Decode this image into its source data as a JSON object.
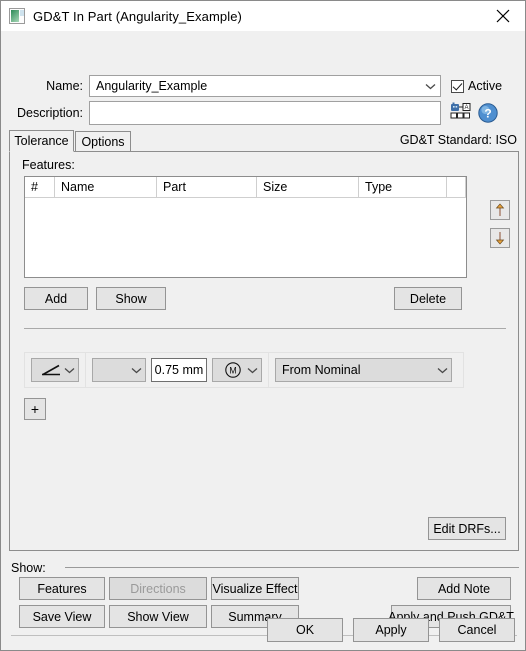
{
  "window": {
    "title": "GD&T In Part (Angularity_Example)",
    "icon": "gdt-part-icon",
    "close_icon": "close-icon"
  },
  "form": {
    "name_label": "Name:",
    "name_value": "Angularity_Example",
    "active_label": "Active",
    "active_checked": true,
    "description_label": "Description:",
    "description_value": "",
    "description_placeholder": "",
    "annotate_icon": "gdt-annotation-icon",
    "help_icon": "help-icon"
  },
  "tabs": {
    "items": [
      {
        "label": "Tolerance",
        "active": true
      },
      {
        "label": "Options",
        "active": false
      }
    ],
    "standard_label": "GD&T Standard: ISO"
  },
  "features": {
    "section_label": "Features:",
    "columns": [
      "#",
      "Name",
      "Part",
      "Size",
      "Type",
      ""
    ],
    "rows": [],
    "move_up_icon": "arrow-up-icon",
    "move_down_icon": "arrow-down-icon",
    "add_label": "Add",
    "show_label": "Show",
    "delete_label": "Delete"
  },
  "tolerance": {
    "symbol": "angularity-symbol",
    "symbol_glyph": "∠",
    "modifier_blank": "",
    "value": "0.75 mm",
    "material_condition": "maximum-material-condition-symbol",
    "material_condition_glyph": "M",
    "datum_reference": "From Nominal",
    "add_row_label": "+",
    "edit_drfs_label": "Edit DRFs..."
  },
  "show_group": {
    "caption": "Show:",
    "buttons": [
      {
        "label": "Features",
        "enabled": true
      },
      {
        "label": "Directions",
        "enabled": false
      },
      {
        "label": "Visualize Effect",
        "enabled": true
      },
      {
        "label": "Add Note",
        "enabled": true
      },
      {
        "label": "Save View",
        "enabled": true
      },
      {
        "label": "Show View",
        "enabled": true
      },
      {
        "label": "Summary",
        "enabled": true
      },
      {
        "label": "Apply and Push GD&T",
        "enabled": true
      }
    ]
  },
  "footer": {
    "ok_label": "OK",
    "apply_label": "Apply",
    "cancel_label": "Cancel"
  },
  "colors": {
    "window_bg": "#f0f0f0",
    "field_bg": "#ffffff",
    "button_bg": "#e4e4e4",
    "border": "#8d8d8d",
    "accent_icon": "#3b6fb5"
  }
}
